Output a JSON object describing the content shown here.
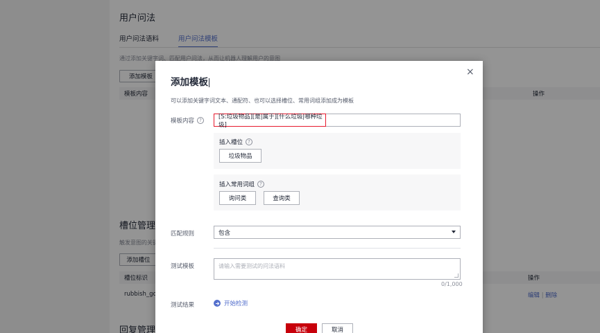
{
  "background": {
    "section1": {
      "title": "用户问法",
      "tabs": [
        {
          "label": "用户问法语料",
          "active": false
        },
        {
          "label": "用户问法模板",
          "active": true
        }
      ],
      "description": "通过添加关键字词、匹配用户问法，从而让机器人理解用户的意图",
      "add_button": "添加模板",
      "columns": {
        "content": "模板内容",
        "actions": "操作"
      }
    },
    "section2": {
      "title": "槽位管理",
      "description": "触发意图的关键",
      "add_button": "添加槽位",
      "columns": {
        "slot_id": "槽位标识",
        "actions": "操作"
      },
      "row": {
        "slot_id": "rubbish_goo",
        "edit": "编辑",
        "separator": "|",
        "delete": "删除"
      }
    },
    "section3": {
      "title": "回复管理"
    }
  },
  "modal": {
    "title": "添加模板",
    "close_icon": "×",
    "description": "可以添加关键字词文本、通配符、也可以选择槽位、常用词组添加成为模板",
    "template_content": {
      "label": "模板内容",
      "help": "?",
      "value": "[S:垃圾物品][是|属于][什么垃圾|哪种垃圾]"
    },
    "insert_slot": {
      "label": "插入槽位",
      "help": "?",
      "chips": [
        "垃圾物品"
      ]
    },
    "insert_phrase": {
      "label": "插入常用词组",
      "help": "?",
      "chips": [
        "询问类",
        "查询类"
      ]
    },
    "match_rule": {
      "label": "匹配规则",
      "value": "包含"
    },
    "test_template": {
      "label": "测试模板",
      "placeholder": "请输入需要测试的问法语料",
      "counter": "0/1,000"
    },
    "test_result": {
      "label": "测试结果",
      "action": "开始检测"
    },
    "confirm_button": "确定",
    "cancel_button": "取消"
  },
  "colors": {
    "accent": "#526ecc",
    "primary_button": "#c7000b",
    "highlight_border": "#e6182c"
  }
}
